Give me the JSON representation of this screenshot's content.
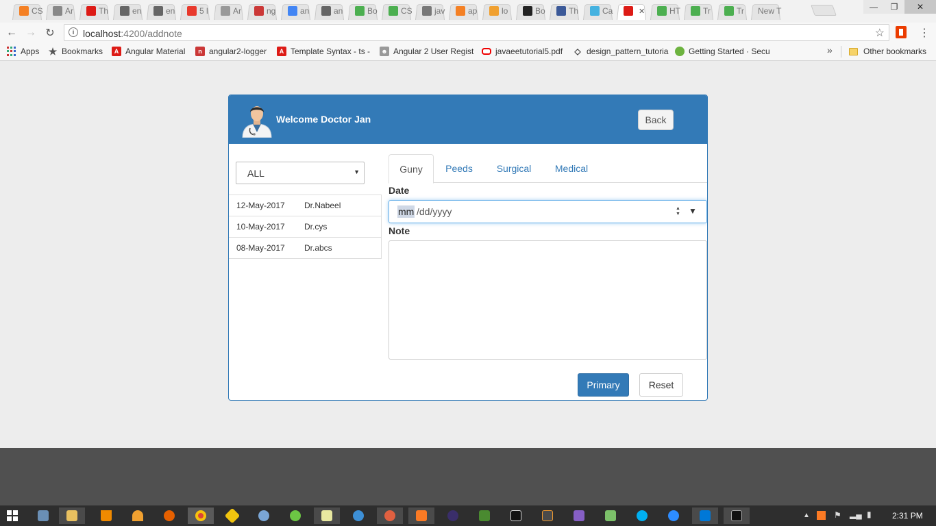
{
  "browser": {
    "tabs": [
      {
        "title": "CS",
        "icon": "stackoverflow-icon",
        "color": "#f48024"
      },
      {
        "title": "Ar",
        "icon": "user-icon",
        "color": "#888888"
      },
      {
        "title": "Th",
        "icon": "angular-icon",
        "color": "#dd1b16"
      },
      {
        "title": "en",
        "icon": "download-icon",
        "color": "#666666"
      },
      {
        "title": "en",
        "icon": "download-icon",
        "color": "#666666"
      },
      {
        "title": "5 l",
        "icon": "as-icon",
        "color": "#e8392c"
      },
      {
        "title": "Ar",
        "icon": "page-icon",
        "color": "#999999"
      },
      {
        "title": "ng",
        "icon": "npm-icon",
        "color": "#cb3837"
      },
      {
        "title": "an",
        "icon": "google-icon",
        "color": "#4285f4"
      },
      {
        "title": "an",
        "icon": "download-icon",
        "color": "#666666"
      },
      {
        "title": "Bo",
        "icon": "w3-icon",
        "color": "#4caf50"
      },
      {
        "title": "CS",
        "icon": "w3-icon",
        "color": "#4caf50"
      },
      {
        "title": "jav",
        "icon": "text-icon",
        "color": "#777777"
      },
      {
        "title": "ap",
        "icon": "stackoverflow-icon",
        "color": "#f48024"
      },
      {
        "title": "lo",
        "icon": "phpmyadmin-icon",
        "color": "#f0a030"
      },
      {
        "title": "Bo",
        "icon": "github-icon",
        "color": "#222222"
      },
      {
        "title": "Th",
        "icon": "facebook-icon",
        "color": "#3b5998"
      },
      {
        "title": "Ca",
        "icon": "hex-icon",
        "color": "#44b2e0"
      },
      {
        "title": "",
        "icon": "angular-icon",
        "color": "#dd1b16",
        "active": true
      },
      {
        "title": "HT",
        "icon": "w3-icon",
        "color": "#4caf50"
      },
      {
        "title": "Tr",
        "icon": "w3-icon",
        "color": "#4caf50"
      },
      {
        "title": "Tr",
        "icon": "w3-icon",
        "color": "#4caf50"
      },
      {
        "title": "New T",
        "icon": "",
        "color": ""
      }
    ],
    "url_host": "localhost",
    "url_path": ":4200/addnote",
    "bookmarks": [
      {
        "label": "Apps",
        "icon": "apps-icon"
      },
      {
        "label": "Bookmarks",
        "icon": "star-icon"
      },
      {
        "label": "Angular Material",
        "icon": "angular-icon"
      },
      {
        "label": "angular2-logger",
        "icon": "npm-icon"
      },
      {
        "label": "Template Syntax - ts -",
        "icon": "angular-icon"
      },
      {
        "label": "Angular 2 User Regist",
        "icon": "user-icon"
      },
      {
        "label": "javaeetutorial5.pdf",
        "icon": "oracle-icon"
      },
      {
        "label": "design_pattern_tutoria",
        "icon": "diamond-icon"
      },
      {
        "label": "Getting Started · Secu",
        "icon": "spring-icon"
      }
    ],
    "other_bookmarks": "Other bookmarks"
  },
  "page": {
    "welcome": "Welcome Doctor Jan",
    "back_label": "Back",
    "filter_value": "ALL",
    "notes": [
      {
        "date": "12-May-2017",
        "doctor": "Dr.Nabeel"
      },
      {
        "date": "10-May-2017",
        "doctor": "Dr.cys"
      },
      {
        "date": "08-May-2017",
        "doctor": "Dr.abcs"
      }
    ],
    "tabs": [
      "Guny",
      "Peeds",
      "Surgical",
      "Medical"
    ],
    "active_tab": "Guny",
    "date_label": "Date",
    "date_placeholder_month": "mm",
    "date_placeholder_rest": "/dd/yyyy",
    "note_label": "Note",
    "primary_label": "Primary",
    "reset_label": "Reset"
  },
  "taskbar": {
    "clock": "2:31 PM"
  },
  "colors": {
    "accent": "#337ab7",
    "page_bg": "#ededed"
  }
}
